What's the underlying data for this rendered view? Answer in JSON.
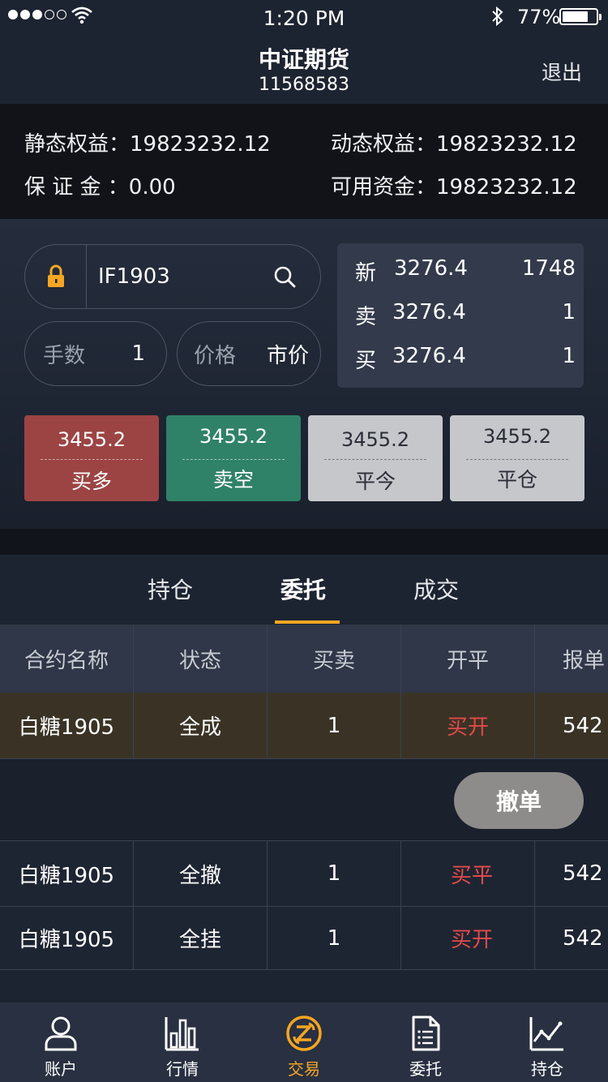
{
  "status_bar": {
    "time": "1:20 PM",
    "battery_percent_text": "77%",
    "battery_level": 0.77,
    "signal_bars_filled": 3,
    "signal_bars_total": 5,
    "icons": [
      "wifi-icon",
      "bluetooth-icon",
      "battery-icon"
    ]
  },
  "header": {
    "title": "中证期货",
    "account": "11568583",
    "logout_label": "退出"
  },
  "equity": {
    "static_label": "静态权益：",
    "static_value": "19823232.12",
    "dynamic_label": "动态权益：",
    "dynamic_value": "19823232.12",
    "margin_label": "保 证 金 ：",
    "margin_value": "0.00",
    "available_label": "可用资金：",
    "available_value": "19823232.12"
  },
  "order_form": {
    "contract_code": "IF1903",
    "quantity_label": "手数",
    "quantity_value": "1",
    "price_label": "价格",
    "price_value": "市价"
  },
  "quote": {
    "rows": [
      {
        "label": "新",
        "price": "3276.4",
        "volume": "1748"
      },
      {
        "label": "卖",
        "price": "3276.4",
        "volume": "1"
      },
      {
        "label": "买",
        "price": "3276.4",
        "volume": "1"
      }
    ]
  },
  "trade_buttons": [
    {
      "price": "3455.2",
      "action": "买多"
    },
    {
      "price": "3455.2",
      "action": "卖空"
    },
    {
      "price": "3455.2",
      "action": "平今"
    },
    {
      "price": "3455.2",
      "action": "平仓"
    }
  ],
  "tabs": [
    {
      "label": "持仓",
      "active": false
    },
    {
      "label": "委托",
      "active": true
    },
    {
      "label": "成交",
      "active": false
    }
  ],
  "table": {
    "headers": [
      "合约名称",
      "状态",
      "买卖",
      "开平",
      "报单"
    ],
    "rows": [
      {
        "name": "白糖1905",
        "status": "全成",
        "side": "1",
        "open_close": "买开",
        "price": "542"
      },
      {
        "name": "白糖1905",
        "status": "全撤",
        "side": "1",
        "open_close": "买平",
        "price": "542"
      },
      {
        "name": "白糖1905",
        "status": "全挂",
        "side": "1",
        "open_close": "买开",
        "price": "542"
      }
    ]
  },
  "cancel_button_label": "撤单",
  "bottom_tabs": [
    {
      "label": "账户",
      "icon": "user-icon",
      "active": false
    },
    {
      "label": "行情",
      "icon": "bar-chart-icon",
      "active": false
    },
    {
      "label": "交易",
      "icon": "trade-icon",
      "active": true
    },
    {
      "label": "委托",
      "icon": "document-icon",
      "active": false
    },
    {
      "label": "持仓",
      "icon": "line-chart-icon",
      "active": false
    }
  ],
  "colors": {
    "accent": "#f5a623",
    "buy": "#9c4444",
    "sell": "#2f8167",
    "neutral_button": "#c6c7cb",
    "up_text": "#e24a4a"
  }
}
